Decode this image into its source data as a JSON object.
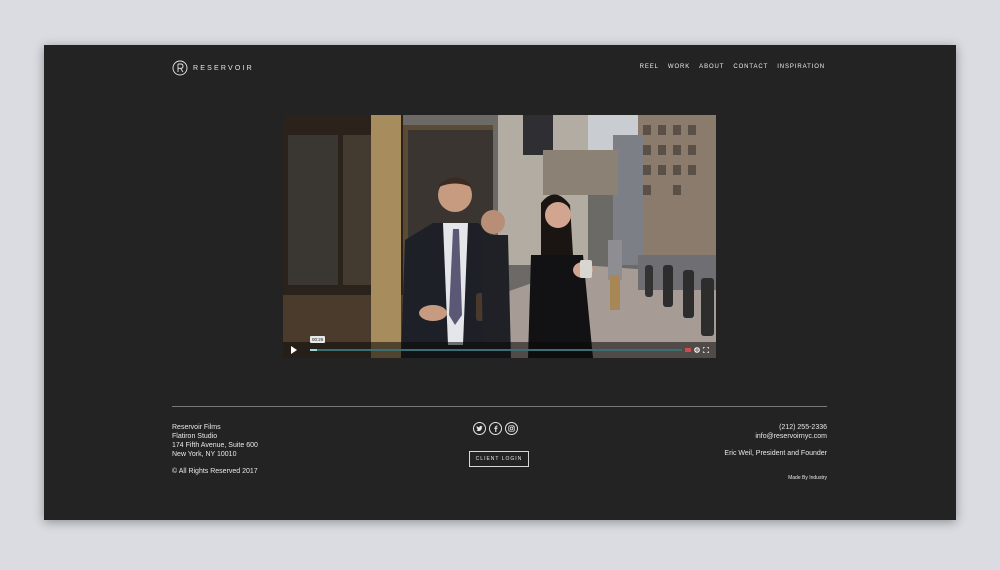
{
  "brand": {
    "name": "RESERVOIR"
  },
  "nav": [
    "REEL",
    "WORK",
    "ABOUT",
    "CONTACT",
    "INSPIRATION"
  ],
  "video": {
    "time": "00:26",
    "progress": 0.02
  },
  "footer": {
    "company": "Reservoir Films",
    "studio": "Flatiron Studio",
    "street": "174 Fifth Avenue, Suite 600",
    "city": "New York, NY 10010",
    "copyright": "© All Rights Reserved 2017",
    "client_login": "CLIENT LOGIN",
    "phone": "(212) 255-2336",
    "email": "info@reservoirnyc.com",
    "founder": "Eric Weil, President and Founder",
    "made_by": "Made By Industry"
  },
  "social": [
    "twitter-icon",
    "facebook-icon",
    "instagram-icon"
  ]
}
